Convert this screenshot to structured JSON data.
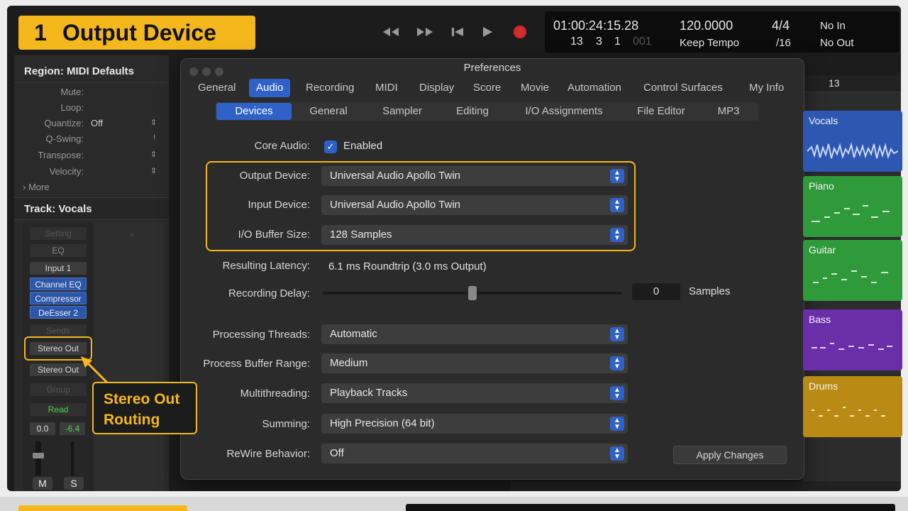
{
  "title_badge": {
    "number": "1",
    "text": "Output Device"
  },
  "transport": {
    "rewind": "◀◀",
    "forward": "▶▶",
    "to_start": "⏮",
    "play": "▶",
    "record": "●"
  },
  "lcd": {
    "time": "01:00:24:15.28",
    "bars": "13",
    "beat": "3",
    "div": "1",
    "tick": "001",
    "tempo": "120.0000",
    "tempo_mode": "Keep Tempo",
    "sig_top": "4/4",
    "sig_bottom": "/16",
    "midi_in": "No In",
    "midi_out": "No Out"
  },
  "inspector": {
    "region_header": "Region: MIDI Defaults",
    "params": [
      {
        "label": "Mute:",
        "value": ""
      },
      {
        "label": "Loop:",
        "value": ""
      },
      {
        "label": "Quantize:",
        "value": "Off"
      },
      {
        "label": "Q-Swing:",
        "value": ""
      },
      {
        "label": "Transpose:",
        "value": ""
      },
      {
        "label": "Velocity:",
        "value": ""
      }
    ],
    "more": "More",
    "track_header": "Track:  Vocals",
    "strip": {
      "setting": "Setting",
      "eq": "EQ",
      "input": "Input 1",
      "plugins": [
        "Channel EQ",
        "Compressor",
        "DeEsser 2"
      ],
      "sends": "Sends",
      "output_highlighted": "Stereo Out",
      "output": "Stereo Out",
      "group": "Group",
      "automation": "Read",
      "volume": "0.0",
      "peak": "-6.4",
      "mute": "M",
      "solo": "S"
    }
  },
  "callout": {
    "line1": "Stereo Out",
    "line2": "Routing"
  },
  "arrangement": {
    "ruler_bar": "13",
    "regions": [
      {
        "name": "Vocals",
        "color": "#2d57b0"
      },
      {
        "name": "Piano",
        "color": "#2f9a3a"
      },
      {
        "name": "Guitar",
        "color": "#2f9a3a"
      },
      {
        "name": "Bass",
        "color": "#6a2fa8"
      },
      {
        "name": "Drums",
        "color": "#b98a14"
      }
    ]
  },
  "preferences": {
    "window_title": "Preferences",
    "tabs": [
      "General",
      "Audio",
      "Recording",
      "MIDI",
      "Display",
      "Score",
      "Movie",
      "Automation",
      "Control Surfaces",
      "My Info"
    ],
    "active_tab": "Audio",
    "subtabs": [
      "Devices",
      "General",
      "Sampler",
      "Editing",
      "I/O Assignments",
      "File Editor",
      "MP3"
    ],
    "active_subtab": "Devices",
    "core_audio": {
      "label": "Core Audio:",
      "checkbox_label": "Enabled",
      "checked": true
    },
    "output_device": {
      "label": "Output Device:",
      "value": "Universal Audio Apollo Twin"
    },
    "input_device": {
      "label": "Input Device:",
      "value": "Universal Audio Apollo Twin"
    },
    "buffer_size": {
      "label": "I/O Buffer Size:",
      "value": "128 Samples"
    },
    "latency": {
      "label": "Resulting Latency:",
      "value": "6.1 ms Roundtrip (3.0 ms Output)"
    },
    "recording_delay": {
      "label": "Recording Delay:",
      "value": "0",
      "unit": "Samples",
      "slider_fraction": 0.5
    },
    "processing_threads": {
      "label": "Processing Threads:",
      "value": "Automatic"
    },
    "process_buffer_range": {
      "label": "Process Buffer Range:",
      "value": "Medium"
    },
    "multithreading": {
      "label": "Multithreading:",
      "value": "Playback Tracks"
    },
    "summing": {
      "label": "Summing:",
      "value": "High Precision (64 bit)"
    },
    "rewire": {
      "label": "ReWire Behavior:",
      "value": "Off"
    },
    "apply_button": "Apply Changes"
  },
  "colors": {
    "highlight": "#f4b81c",
    "accent_blue": "#2f62c8",
    "record_red": "#d42b2b"
  }
}
